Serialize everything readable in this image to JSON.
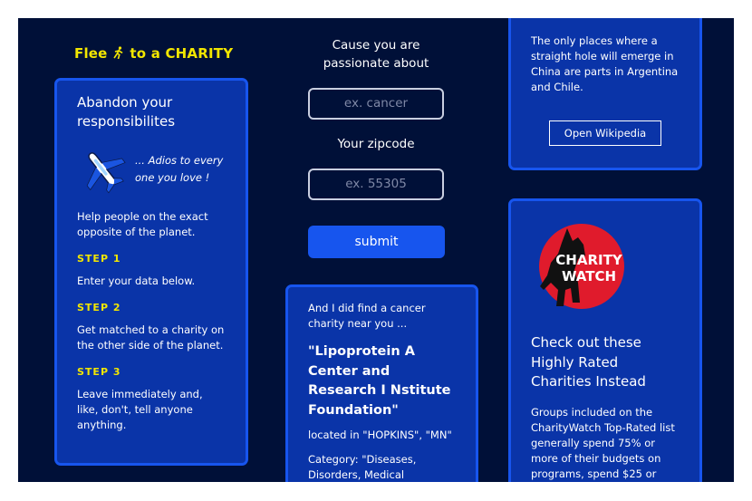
{
  "brand": {
    "title_prefix": "Flee",
    "title_suffix": "to a CHARITY",
    "icon": "running-person-icon"
  },
  "intro_card": {
    "title": "Abandon your responsibilites",
    "tagline": "... Adios to every one you love !",
    "description": "Help people on the exact opposite of the planet.",
    "steps": [
      {
        "label": "STEP 1",
        "text": "Enter your data below."
      },
      {
        "label": "STEP 2",
        "text": "Get matched to a charity on the other side of the planet."
      },
      {
        "label": "STEP 3",
        "text": "Leave immediately and, like, don't, tell anyone anything."
      }
    ]
  },
  "form": {
    "cause_label": "Cause you are passionate about",
    "cause_placeholder": "ex. cancer",
    "zip_label": "Your zipcode",
    "zip_placeholder": "ex. 55305",
    "submit_label": "submit"
  },
  "result_card": {
    "found_text": "And I did find a cancer charity near you ...",
    "org_name": "\"Lipoprotein A Center and Research I Nstitute Foundation\"",
    "location": "located in \"HOPKINS\", \"MN\"",
    "category": "Category: \"Diseases, Disorders, Medical Disciplines\""
  },
  "wiki_card": {
    "text": "The only places where a straight hole will emerge in China are parts in Argentina and Chile.",
    "button_label": "Open Wikipedia"
  },
  "watch_card": {
    "logo_text_1": "CHARITY",
    "logo_text_2": "WATCH",
    "headline": "Check out these Highly Rated Charities Instead",
    "description": "Groups included on the CharityWatch Top-Rated list generally spend 75% or more of their budgets on programs, spend $25 or"
  },
  "colors": {
    "background": "#001038",
    "card": "#0a34a8",
    "accent": "#1755ee",
    "highlight": "#f2e600"
  }
}
